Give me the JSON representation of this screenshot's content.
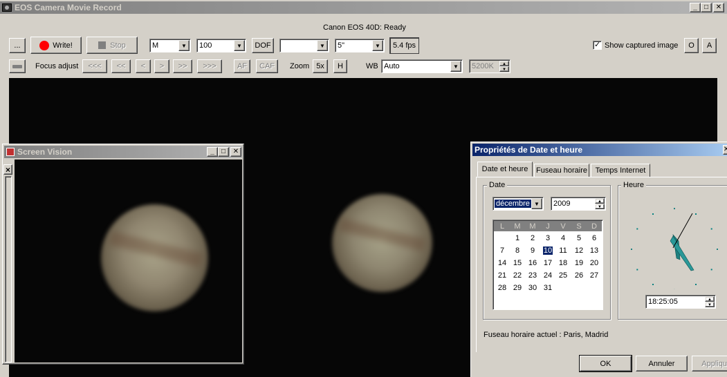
{
  "main_window": {
    "title": "EOS Camera Movie Record",
    "status": "Canon EOS 40D: Ready",
    "toolbar": {
      "more_label": "...",
      "write_label": "Write!",
      "stop_label": "Stop",
      "mode_value": "M",
      "iso_value": "100",
      "dof_label": "DOF",
      "blank_combo_value": "",
      "shutter_value": "5\"",
      "fps_label": "5.4 fps",
      "show_captured_label": "Show captured image",
      "show_captured_checked": true,
      "o_label": "O",
      "a_label": "A"
    },
    "focus_row": {
      "focus_adjust_label": "Focus adjust",
      "focus_buttons": [
        "<<<",
        "<<",
        "<",
        ">",
        ">>",
        ">>>"
      ],
      "af_label": "AF",
      "caf_label": "CAF",
      "zoom_label": "Zoom",
      "zoom_5x_label": "5x",
      "h_label": "H",
      "wb_label": "WB",
      "wb_value": "Auto",
      "kelvin_value": "5200K"
    }
  },
  "screen_vision": {
    "title": "Screen Vision",
    "close_glyph": "×"
  },
  "date_dialog": {
    "title": "Propriétés de Date et heure",
    "tabs": [
      "Date et heure",
      "Fuseau horaire",
      "Temps Internet"
    ],
    "date_group": "Date",
    "time_group": "Heure",
    "month_value": "décembre",
    "year_value": "2009",
    "weekdays": [
      "L",
      "M",
      "M",
      "J",
      "V",
      "S",
      "D"
    ],
    "weeks": [
      [
        "",
        "1",
        "2",
        "3",
        "4",
        "5",
        "6"
      ],
      [
        "7",
        "8",
        "9",
        "10",
        "11",
        "12",
        "13"
      ],
      [
        "14",
        "15",
        "16",
        "17",
        "18",
        "19",
        "20"
      ],
      [
        "21",
        "22",
        "23",
        "24",
        "25",
        "26",
        "27"
      ],
      [
        "28",
        "29",
        "30",
        "31",
        "",
        "",
        ""
      ]
    ],
    "selected_day": "10",
    "time_value": "18:25:05",
    "timezone_text": "Fuseau horaire actuel : Paris, Madrid",
    "ok_label": "OK",
    "cancel_label": "Annuler",
    "apply_label": "Appliquer"
  }
}
